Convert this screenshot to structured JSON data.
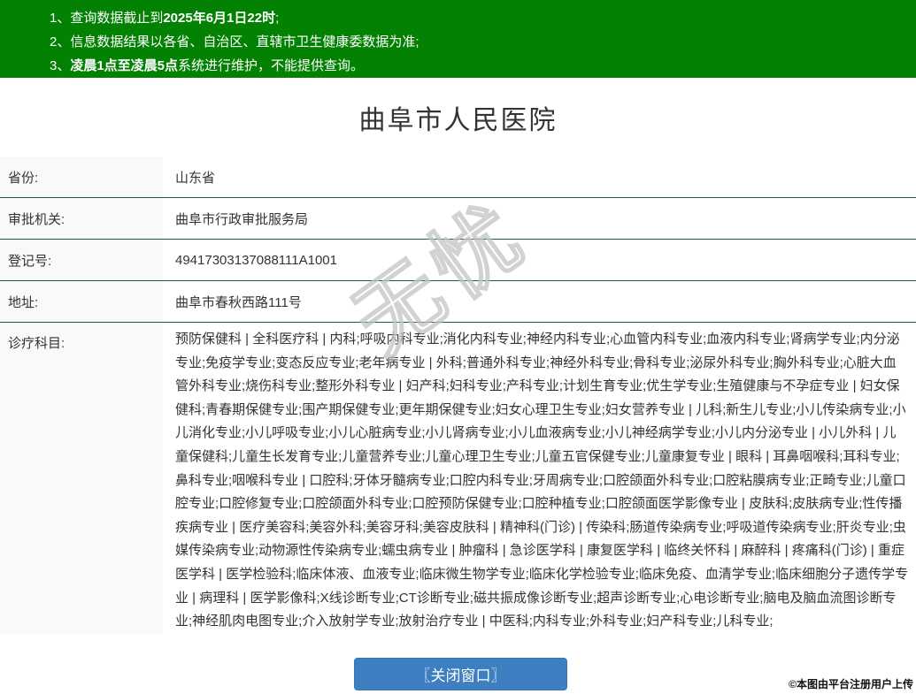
{
  "notice_banner": {
    "bg_color": "#028102",
    "items": [
      {
        "prefix": "1、查询数据截止到",
        "bold": "2025年6月1日22时",
        "suffix": ";"
      },
      {
        "prefix": "2、信息数据结果以各省、自治区、直辖市卫生健康委数据为准;",
        "bold": "",
        "suffix": ""
      },
      {
        "prefix": "3、",
        "bold": "凌晨1点至凌晨5点",
        "suffix": "系统进行维护，不能提供查询。"
      }
    ]
  },
  "page_title": "曲阜市人民医院",
  "info_table": {
    "rows": [
      {
        "label": "省份:",
        "value": "山东省"
      },
      {
        "label": "审批机关:",
        "value": "曲阜市行政审批服务局"
      },
      {
        "label": "登记号:",
        "value": "49417303137088111A1001"
      },
      {
        "label": "地址:",
        "value": "曲阜市春秋西路111号"
      },
      {
        "label": "诊疗科目:",
        "value": "预防保健科 | 全科医疗科 | 内科;呼吸内科专业;消化内科专业;神经内科专业;心血管内科专业;血液内科专业;肾病学专业;内分泌专业;免疫学专业;变态反应专业;老年病专业 | 外科;普通外科专业;神经外科专业;骨科专业;泌尿外科专业;胸外科专业;心脏大血管外科专业;烧伤科专业;整形外科专业 | 妇产科;妇科专业;产科专业;计划生育专业;优生学专业;生殖健康与不孕症专业 | 妇女保健科;青春期保健专业;围产期保健专业;更年期保健专业;妇女心理卫生专业;妇女营养专业 | 儿科;新生儿专业;小儿传染病专业;小儿消化专业;小儿呼吸专业;小儿心脏病专业;小儿肾病专业;小儿血液病专业;小儿神经病学专业;小儿内分泌专业 | 小儿外科 | 儿童保健科;儿童生长发育专业;儿童营养专业;儿童心理卫生专业;儿童五官保健专业;儿童康复专业 | 眼科 | 耳鼻咽喉科;耳科专业;鼻科专业;咽喉科专业 | 口腔科;牙体牙髓病专业;口腔内科专业;牙周病专业;口腔颌面外科专业;口腔粘膜病专业;正畸专业;儿童口腔专业;口腔修复专业;口腔颌面外科专业;口腔预防保健专业;口腔种植专业;口腔颌面医学影像专业 | 皮肤科;皮肤病专业;性传播疾病专业 | 医疗美容科;美容外科;美容牙科;美容皮肤科 | 精神科(门诊) | 传染科;肠道传染病专业;呼吸道传染病专业;肝炎专业;虫媒传染病专业;动物源性传染病专业;蠕虫病专业 | 肿瘤科 | 急诊医学科 | 康复医学科 | 临终关怀科 | 麻醉科 | 疼痛科(门诊) | 重症医学科 | 医学检验科;临床体液、血液专业;临床微生物学专业;临床化学检验专业;临床免疫、血清学专业;临床细胞分子遗传学专业 | 病理科 | 医学影像科;X线诊断专业;CT诊断专业;磁共振成像诊断专业;超声诊断专业;心电诊断专业;脑电及脑血流图诊断专业;神经肌肉电图专业;介入放射学专业;放射治疗专业 | 中医科;内科专业;外科专业;妇产科专业;儿科专业;"
      }
    ]
  },
  "close_button_label": "〖关闭窗口〗",
  "watermark_text": "无忧",
  "footer_note": "©本图由平台注册用户上传",
  "colors": {
    "banner_green": "#028102",
    "table_border_green": "#1b5d38",
    "label_cell_bg": "#f9f9f9",
    "button_blue": "#3d7fc1",
    "text": "#333333"
  }
}
